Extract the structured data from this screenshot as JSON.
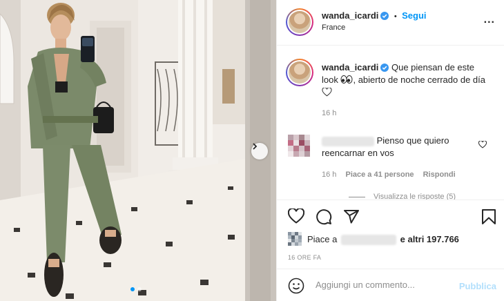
{
  "header": {
    "username": "wanda_icardi",
    "follow_label": "Segui",
    "separator": "•",
    "location": "France",
    "more_label": "..."
  },
  "caption": {
    "username": "wanda_icardi",
    "text_before": "Que piensan de este look ",
    "text_after": ", abierto de noche cerrado de día ",
    "time": "16 h"
  },
  "comment": {
    "text": "Pienso que quiero reencarnar en vos",
    "time": "16 h",
    "likes": "Piace a 41 persone",
    "reply": "Rispondi"
  },
  "view_replies": "Visualizza le risposte (5)",
  "likes": {
    "prefix": "Piace a",
    "suffix": "e altri 197.766"
  },
  "post_time": "16 ORE FA",
  "comment_box": {
    "placeholder": "Aggiungi un commento...",
    "publish": "Pubblica"
  },
  "carousel": {
    "slides": 2,
    "active": 1
  },
  "colors": {
    "accent": "#0095f6",
    "publish_disabled": "#b2dffc",
    "muted": "#8e8e8e"
  },
  "icons": [
    "verified-badge-icon",
    "more-options-icon",
    "heart-icon",
    "comment-icon",
    "share-icon",
    "bookmark-icon",
    "emoji-icon",
    "eyes-emoji",
    "white-heart-emoji",
    "next-slide-icon"
  ]
}
